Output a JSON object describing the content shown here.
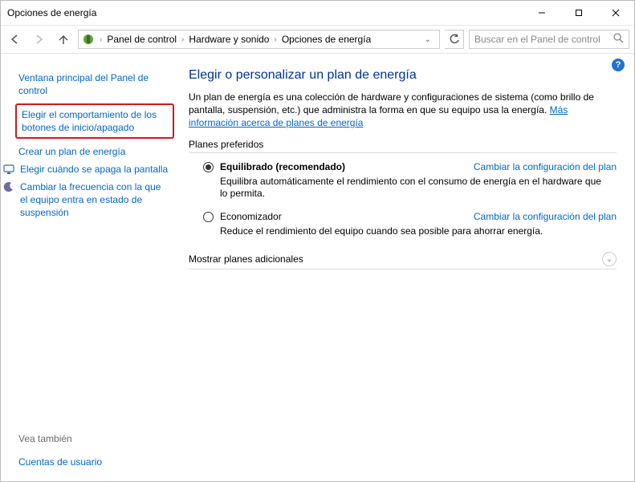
{
  "window": {
    "title": "Opciones de energía"
  },
  "breadcrumbs": {
    "items": [
      "Panel de control",
      "Hardware y sonido",
      "Opciones de energía"
    ]
  },
  "search": {
    "placeholder": "Buscar en el Panel de control"
  },
  "sidebar": {
    "main_page": "Ventana principal del Panel de control",
    "choose_buttons": "Elegir el comportamiento de los botones de inicio/apagado",
    "create_plan": "Crear un plan de energía",
    "choose_display_off": "Elegir cuándo se apaga la pantalla",
    "change_sleep": "Cambiar la frecuencia con la que el equipo entra en estado de suspensión",
    "see_also_hdr": "Vea también",
    "see_also_link": "Cuentas de usuario"
  },
  "main": {
    "heading": "Elegir o personalizar un plan de energía",
    "description_pre": "Un plan de energía es una colección de hardware y configuraciones de sistema (como brillo de pantalla, suspensión, etc.) que administra la forma en que su equipo usa la energía. ",
    "description_link": "Más información acerca de planes de energía",
    "preferred_hdr": "Planes preferidos",
    "plans": [
      {
        "name": "Equilibrado (recomendado)",
        "change": "Cambiar la configuración del plan",
        "desc": "Equilibra automáticamente el rendimiento con el consumo de energía en el hardware que lo permita.",
        "selected": true
      },
      {
        "name": "Economizador",
        "change": "Cambiar la configuración del plan",
        "desc": "Reduce el rendimiento del equipo cuando sea posible para ahorrar energía.",
        "selected": false
      }
    ],
    "show_more": "Mostrar planes adicionales"
  }
}
